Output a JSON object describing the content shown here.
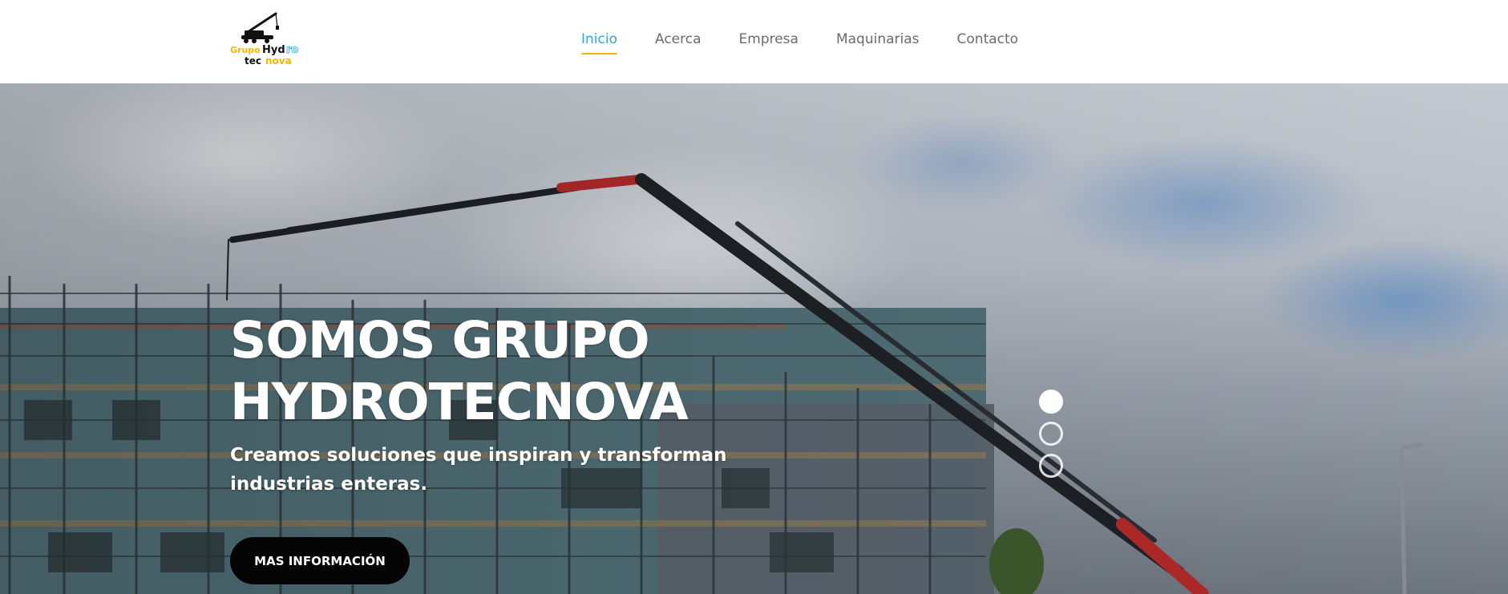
{
  "brand": {
    "logo_word_1": "Grupo",
    "logo_word_2": "Hyd",
    "logo_word_3": "ro",
    "logo_word_4": "tec",
    "logo_word_5": "nova",
    "colors": {
      "yellow": "#f2b705",
      "blue": "#29a8de",
      "dark": "#111111"
    }
  },
  "nav": {
    "items": [
      {
        "label": "Inicio",
        "active": true
      },
      {
        "label": "Acerca",
        "active": false
      },
      {
        "label": "Empresa",
        "active": false
      },
      {
        "label": "Maquinarias",
        "active": false
      },
      {
        "label": "Contacto",
        "active": false
      }
    ]
  },
  "hero": {
    "title_line1": "SOMOS GRUPO",
    "title_line2": "HYDROTECNOVA",
    "subtitle_line1": "Creamos soluciones que inspiran y transforman",
    "subtitle_line2": "industrias enteras.",
    "cta_label": "MAS INFORMACIÓN",
    "background_image": "crane-construction-site-photo"
  },
  "slider": {
    "slide_count": 3,
    "active_index": 0
  }
}
